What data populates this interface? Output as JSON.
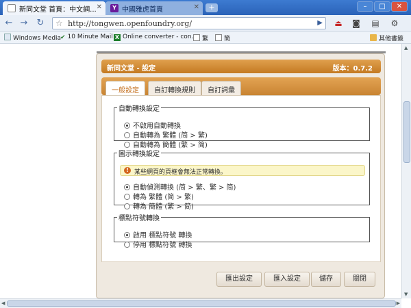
{
  "browser": {
    "tabs": [
      {
        "title": "新同文堂 首頁：中文網...",
        "active": true
      },
      {
        "title": "中國雅虎首頁",
        "active": false
      }
    ],
    "new_tab": "+",
    "url": "http://tongwen.openfoundry.org/",
    "bookmarks": [
      {
        "label": "Windows Media",
        "icon": "media-icon"
      },
      {
        "label": "10 Minute Mail",
        "icon": "mail-icon"
      },
      {
        "label": "Online converter - con...",
        "icon": "converter-icon"
      },
      {
        "label": "繁",
        "icon": "page-icon"
      },
      {
        "label": "簡",
        "icon": "page-icon"
      }
    ],
    "other_bookmarks": "其他書籤"
  },
  "dialog": {
    "title": "新同文堂 - 設定",
    "version": "版本：0.7.2",
    "tabs": [
      "一般設定",
      "自訂轉換規則",
      "自訂詞彙"
    ],
    "groups": {
      "auto": {
        "legend": "自動轉換設定",
        "options": [
          "不啟用自動轉換",
          "自動轉為 繁體 (简 > 繁)",
          "自動轉為 簡體 (繁 > 简)"
        ],
        "selected": 0
      },
      "display": {
        "legend": "圖示轉換設定",
        "warning": "某些網頁的頁框會無法正常轉換。",
        "options": [
          "自動偵測轉換 (简 > 繁、繁 > 简)",
          "轉為 繁體 (简 > 繁)",
          "轉為 簡體 (繁 > 简)"
        ],
        "selected": 0
      },
      "punct": {
        "legend": "標點符號轉換",
        "options": [
          "啟用 標點符號 轉換",
          "停用 標點符號 轉換"
        ],
        "selected": 0
      }
    },
    "buttons": [
      "匯出設定",
      "匯入設定",
      "儲存",
      "關閉"
    ]
  }
}
